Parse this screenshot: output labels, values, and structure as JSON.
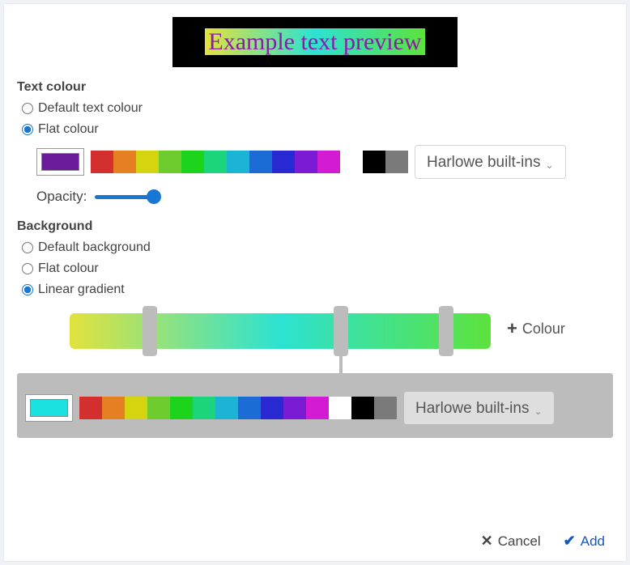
{
  "preview": {
    "text": "Example text preview"
  },
  "text_colour": {
    "heading": "Text colour",
    "options": {
      "default": "Default text colour",
      "flat": "Flat colour"
    },
    "selected_colour": "#6a1b9a",
    "palette": [
      "#d32f2f",
      "#e67e22",
      "#d4d40f",
      "#6ecc2e",
      "#1bd41b",
      "#1bd47b",
      "#1bb4d4",
      "#1b6cd4",
      "#2929d4",
      "#7b1bd4",
      "#d41bd4",
      "#ffffff",
      "#000000",
      "#7a7a7a"
    ],
    "builtins_label": "Harlowe built-ins",
    "opacity_label": "Opacity:"
  },
  "background": {
    "heading": "Background",
    "options": {
      "default": "Default background",
      "flat": "Flat colour",
      "gradient": "Linear gradient"
    },
    "add_colour_label": "Colour",
    "stop_editor": {
      "colour": "#1be0e0",
      "palette": [
        "#d32f2f",
        "#e67e22",
        "#d4d40f",
        "#6ecc2e",
        "#1bd41b",
        "#1bd47b",
        "#1bb4d4",
        "#1b6cd4",
        "#2929d4",
        "#7b1bd4",
        "#d41bd4",
        "#ffffff",
        "#000000",
        "#7a7a7a"
      ],
      "builtins_label": "Harlowe built-ins"
    }
  },
  "footer": {
    "cancel": "Cancel",
    "add": "Add"
  }
}
